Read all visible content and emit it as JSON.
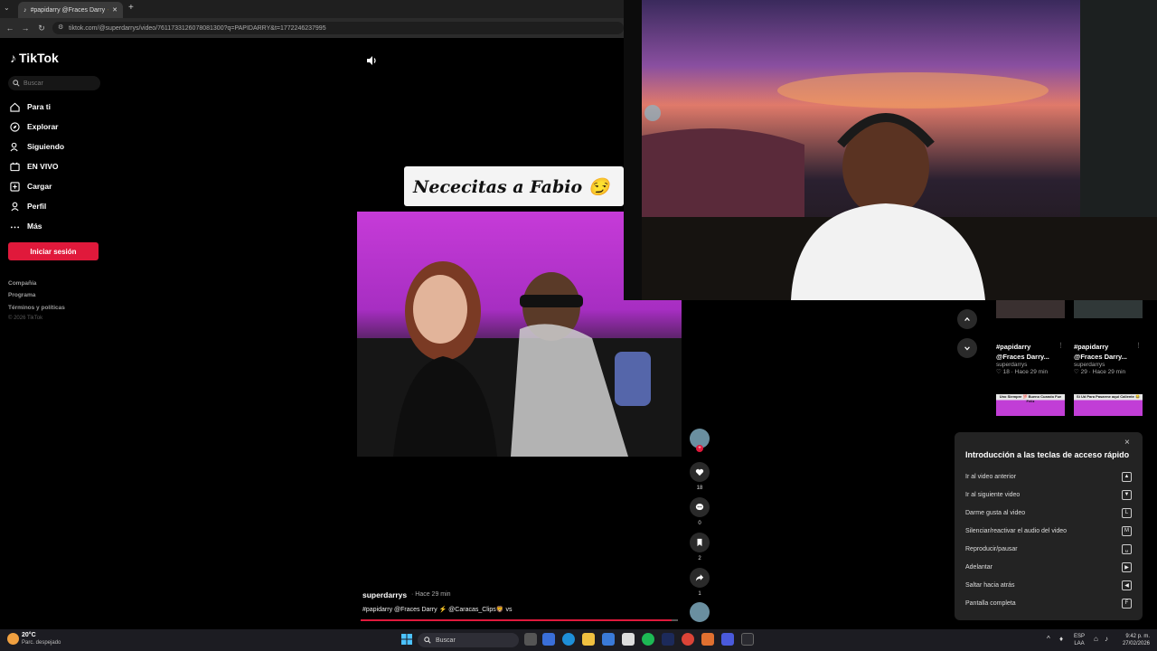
{
  "browser": {
    "tab_title": "#papidarry @Fraces Darry ⚡ ...",
    "url": "tiktok.com/@superdarrys/video/761173312607808130​0?q=PAPIDARRY&t=1772246237995"
  },
  "sidebar": {
    "logo": "TikTok",
    "search_placeholder": "Buscar",
    "items": [
      {
        "label": "Para ti",
        "icon": "home-icon"
      },
      {
        "label": "Explorar",
        "icon": "compass-icon"
      },
      {
        "label": "Siguiendo",
        "icon": "following-icon"
      },
      {
        "label": "EN VIVO",
        "icon": "live-icon"
      },
      {
        "label": "Cargar",
        "icon": "upload-icon"
      },
      {
        "label": "Perfil",
        "icon": "profile-icon"
      },
      {
        "label": "Más",
        "icon": "more-icon"
      }
    ],
    "login_label": "Iniciar sesión",
    "footer_links": [
      "Compañía",
      "Programa",
      "Términos y políticas"
    ],
    "copyright": "© 2026 TikTok"
  },
  "video": {
    "caption_overlay": "Nececitas a Fabio 😏",
    "author": "superdarrys",
    "posted": "· Hace 29 min",
    "description": "#papidarry @Fraces Darry ⚡ @Caracas_Clips🦁 vs",
    "progress": 0.98,
    "likes": "18",
    "comments": "0",
    "saves": "2",
    "shares": "1"
  },
  "related": {
    "cards": [
      {
        "title": "#papidarry @Fraces Darry...",
        "author": "superdarrys",
        "meta": "♡ 18 · Hace 29 min"
      },
      {
        "title": "#papidarry @Fraces Darry...",
        "author": "superdarrys",
        "meta": "♡ 29 · Hace 29 min"
      }
    ],
    "thumb_captions": [
      "Uno Siempre 💯 Bueno Cuando Fue Feliz",
      "Si Ud Para Pasarme aqui Caliente 😂"
    ]
  },
  "shortcuts": {
    "title": "Introducción a las teclas de acceso rápido",
    "close": "×",
    "rows": [
      {
        "label": "Ir al video anterior",
        "key": "▲"
      },
      {
        "label": "Ir al siguiente video",
        "key": "▼"
      },
      {
        "label": "Darme gusta al video",
        "key": "L"
      },
      {
        "label": "Silenciar/reactivar el audio del video",
        "key": "M"
      },
      {
        "label": "Reproducir/pausar",
        "key": "␣"
      },
      {
        "label": "Adelantar",
        "key": "▶"
      },
      {
        "label": "Saltar hacia atrás",
        "key": "◀"
      },
      {
        "label": "Pantalla completa",
        "key": "F"
      }
    ]
  },
  "taskbar": {
    "weather_temp": "20°C",
    "weather_desc": "Parc. despejado",
    "search": "Buscar",
    "lang_line1": "ESP",
    "lang_line2": "LAA",
    "time": "9:42 p. m.",
    "date": "27/02/2026"
  },
  "colors": {
    "accent": "#e0193b",
    "video_purple": "#c13ed6"
  }
}
